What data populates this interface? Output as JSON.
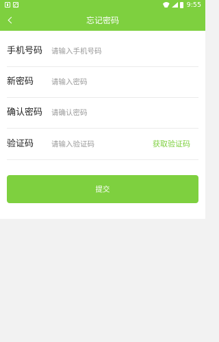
{
  "status_bar": {
    "time": "9:55",
    "icons": [
      "notification-icon",
      "notification-icon",
      "wifi-icon",
      "signal-icon",
      "battery-icon"
    ]
  },
  "nav": {
    "title": "忘记密码",
    "back_icon": "chevron-left-icon"
  },
  "form": {
    "phone": {
      "label": "手机号码",
      "placeholder": "请输入手机号码",
      "value": ""
    },
    "new_password": {
      "label": "新密码",
      "placeholder": "请输入密码",
      "value": ""
    },
    "confirm_password": {
      "label": "确认密码",
      "placeholder": "请确认密码",
      "value": ""
    },
    "code": {
      "label": "验证码",
      "placeholder": "请输入验证码",
      "value": "",
      "get_code_label": "获取验证码"
    }
  },
  "submit_label": "提交",
  "colors": {
    "accent": "#7ed03f",
    "background": "#f2f2f2",
    "surface": "#ffffff",
    "label_text": "#222222",
    "placeholder_text": "#9a9a9a"
  }
}
